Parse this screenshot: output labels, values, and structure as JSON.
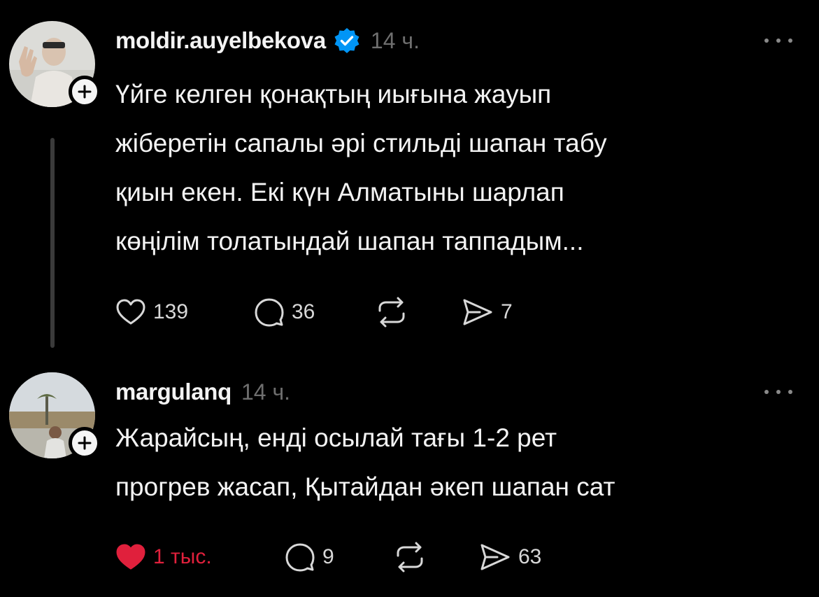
{
  "colors": {
    "background": "#000000",
    "text": "#f3f3f3",
    "muted": "#6e6e6e",
    "verified": "#0095f6",
    "liked": "#e0203c"
  },
  "posts": [
    {
      "username": "moldir.auyelbekova",
      "verified": true,
      "timestamp": "14 ч.",
      "text": "Үйге келген қонақтың иығына жауып\nжіберетін сапалы әрі стильді шапан табу\nқиын екен. Екі күн Алматыны шарлап\nкөңілім толатындай шапан таппадым...",
      "likes": "139",
      "liked": false,
      "comments": "36",
      "reposts": "",
      "shares": "7"
    },
    {
      "username": "margulanq",
      "verified": false,
      "timestamp": "14 ч.",
      "text": "Жарайсың, енді осылай тағы 1-2 рет\nпрогрев жасап, Қытайдан әкеп шапан сат",
      "likes": "1 тыс.",
      "liked": true,
      "comments": "9",
      "reposts": "",
      "shares": "63"
    }
  ]
}
